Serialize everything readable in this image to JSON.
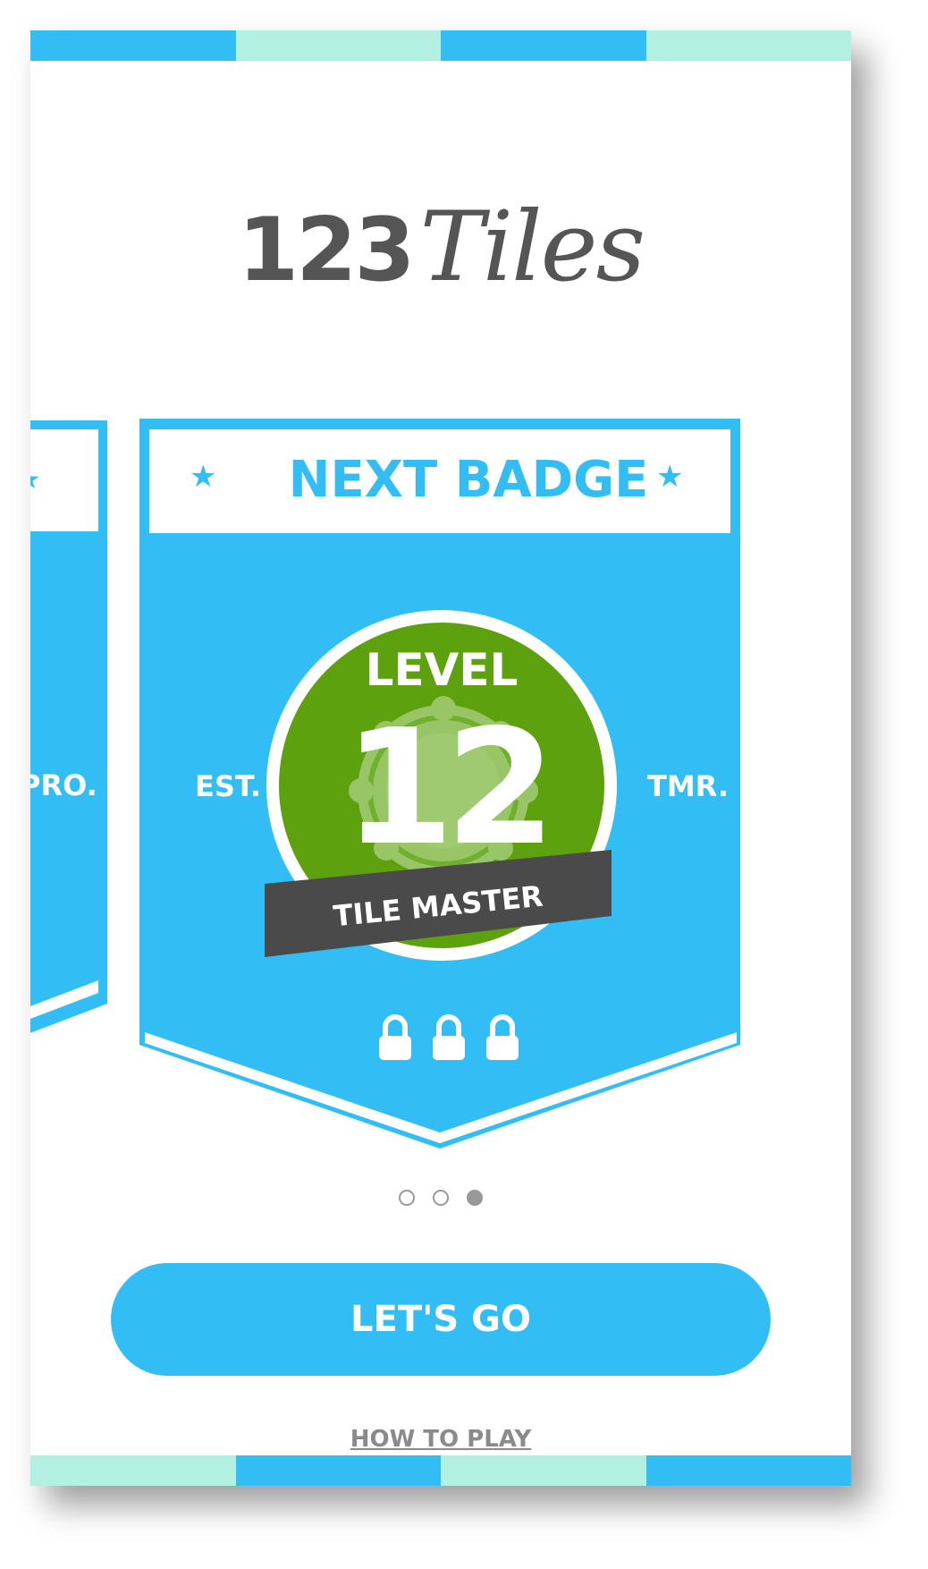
{
  "colors": {
    "accent_blue": "#33bdf5",
    "mint": "#b2f0e2",
    "badge_green": "#5ea10f",
    "ribbon_dark": "#4a4a4a",
    "text_gray": "#555555",
    "dot_gray": "#999999"
  },
  "stripes": {
    "top": [
      "#33bdf5",
      "#b2f0e2",
      "#33bdf5",
      "#b2f0e2"
    ],
    "bottom": [
      "#b2f0e2",
      "#33bdf5",
      "#b2f0e2",
      "#33bdf5"
    ]
  },
  "logo": {
    "number": "123",
    "word": "Tiles"
  },
  "carousel": {
    "prev_card_side_label": "PRO.",
    "card": {
      "title": "NEXT BADGE",
      "star_icon": "star-icon",
      "left_label": "EST.",
      "right_label": "TMR.",
      "badge": {
        "level_label": "LEVEL",
        "level_number": "12",
        "ribbon_text": "TILE MASTER",
        "seal_icon": "rosette-seal-icon"
      },
      "locks": [
        "lock-icon",
        "lock-icon",
        "lock-icon"
      ]
    },
    "pagination": {
      "total": 3,
      "active_index": 2
    }
  },
  "cta": {
    "label": "LET'S GO"
  },
  "how_to_play": {
    "label": "HOW TO PLAY"
  }
}
